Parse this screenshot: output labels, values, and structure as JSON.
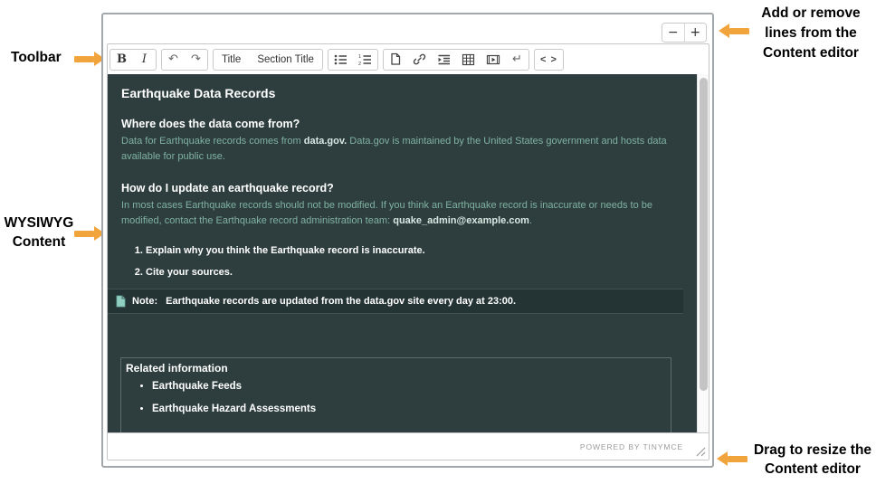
{
  "annotations": {
    "toolbar": "Toolbar",
    "wysiwyg": "WYSIWYG\nContent",
    "add_remove": "Add or remove\nlines from the\nContent editor",
    "drag_resize": "Drag to resize the\nContent editor"
  },
  "stepper": {
    "minus": "−",
    "plus": "+"
  },
  "toolbar": {
    "bold": "B",
    "italic": "I",
    "undo": "↶",
    "redo": "↷",
    "title": "Title",
    "section_title": "Section Title",
    "linebreak": "↵",
    "code": "< >"
  },
  "content": {
    "title": "Earthquake Data Records",
    "q1": "Where does the data come from?",
    "p1_pre": "Data for Earthquake records comes from ",
    "p1_strong": "data.gov.",
    "p1_post": "  Data.gov is maintained by the United States government and hosts data available for public use.",
    "q2": "How do I update an earthquake record?",
    "p2_pre": "In most cases Earthquake records should not be modified.  If you think an Earthquake record is inaccurate or needs to be modified, contact the Earthquake record administration team:  ",
    "p2_email": "quake_admin@example.com",
    "p2_post": ".",
    "steps": [
      "Explain why you think the Earthquake record is inaccurate.",
      "Cite your sources."
    ],
    "note_label": "Note:",
    "note_text": "Earthquake records are updated from the data.gov site every day at 23:00.",
    "related": {
      "title": "Related information",
      "links": [
        "Earthquake Feeds",
        "Earthquake Hazard Assessments"
      ]
    }
  },
  "footer": {
    "powered_by": "POWERED BY TINYMCE"
  },
  "colors": {
    "annotation_arrow": "#F2A43C",
    "editor_background": "#2E3E3E",
    "note_background": "#243333",
    "body_text_green": "#7FB2A1",
    "highlight_text": "#D9E8E2",
    "heading_text": "#FFFFFF"
  }
}
